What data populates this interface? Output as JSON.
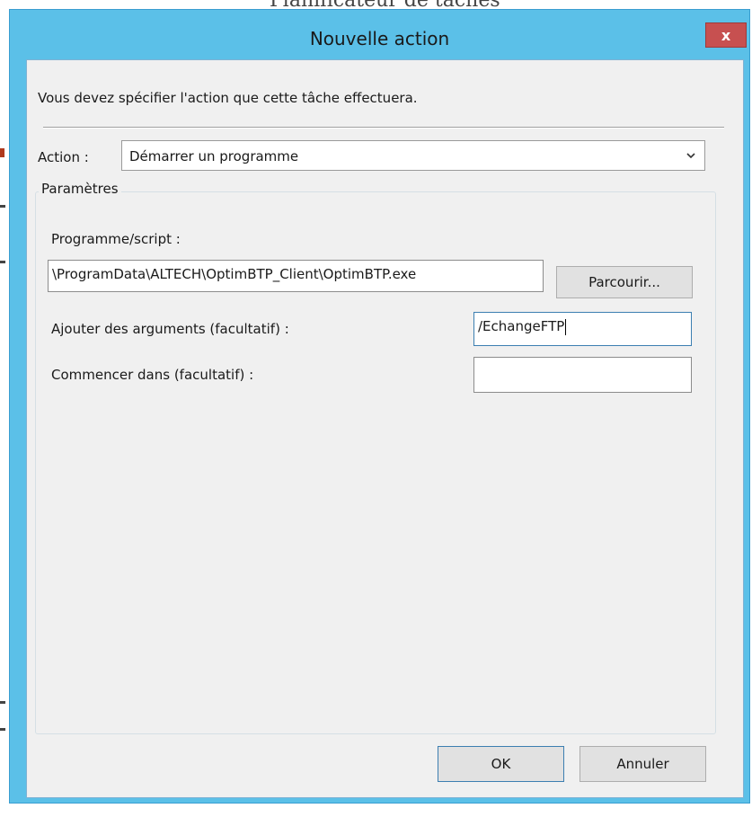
{
  "background_window": {
    "title_fragment": "Planificateur de tâches"
  },
  "dialog": {
    "title": "Nouvelle action",
    "close_glyph": "x",
    "instruction": "Vous devez spécifier l'action que cette tâche effectuera.",
    "action": {
      "label": "Action :",
      "selected_value": "Démarrer un programme",
      "dropdown_icon": "chevron-down-icon"
    },
    "parameters": {
      "group_label": "Paramètres",
      "program": {
        "label": "Programme/script :",
        "value": "\\ProgramData\\ALTECH\\OptimBTP_Client\\OptimBTP.exe",
        "browse_label": "Parcourir..."
      },
      "arguments": {
        "label": "Ajouter des arguments (facultatif) :",
        "value": "/EchangeFTP"
      },
      "start_in": {
        "label": "Commencer dans (facultatif) :",
        "value": ""
      }
    },
    "buttons": {
      "ok": "OK",
      "cancel": "Annuler"
    }
  },
  "colors": {
    "title_bar": "#5bc0e8",
    "close_button": "#c75050",
    "client_background": "#f0f0f0",
    "focus_border": "#3c7fb1"
  }
}
